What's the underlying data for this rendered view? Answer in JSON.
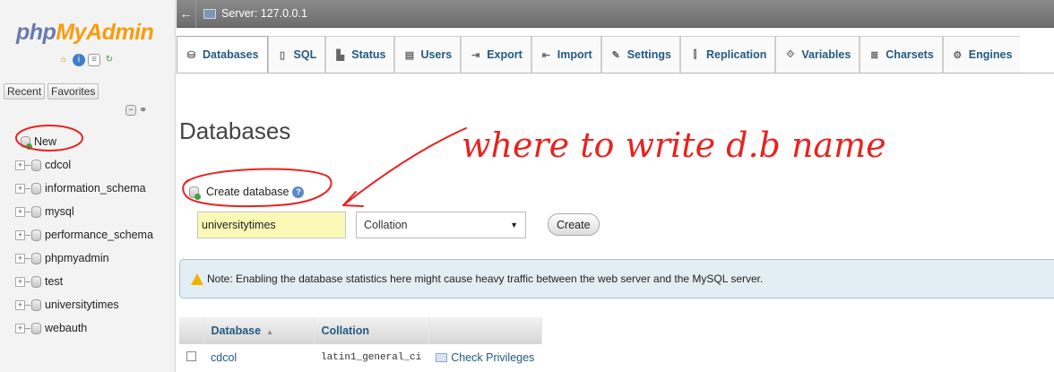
{
  "sidebar": {
    "logo": {
      "php": "php",
      "myadmin": "MyAdmin"
    },
    "logo_icons": [
      "home-icon",
      "info-icon",
      "docs-icon",
      "reload-icon"
    ],
    "nav_tabs": [
      "Recent",
      "Favorites"
    ],
    "tree": {
      "new_label": "New",
      "databases": [
        "cdcol",
        "information_schema",
        "mysql",
        "performance_schema",
        "phpmyadmin",
        "test",
        "universitytimes",
        "webauth"
      ]
    }
  },
  "server_bar": {
    "back": "←",
    "label": "Server: 127.0.0.1"
  },
  "tabs": [
    {
      "label": "Databases",
      "icon": "database-icon"
    },
    {
      "label": "SQL",
      "icon": "sql-icon"
    },
    {
      "label": "Status",
      "icon": "status-icon"
    },
    {
      "label": "Users",
      "icon": "users-icon"
    },
    {
      "label": "Export",
      "icon": "export-icon"
    },
    {
      "label": "Import",
      "icon": "import-icon"
    },
    {
      "label": "Settings",
      "icon": "settings-icon"
    },
    {
      "label": "Replication",
      "icon": "replication-icon"
    },
    {
      "label": "Variables",
      "icon": "variables-icon"
    },
    {
      "label": "Charsets",
      "icon": "charsets-icon"
    },
    {
      "label": "Engines",
      "icon": "engines-icon"
    }
  ],
  "main": {
    "title": "Databases",
    "create_database": {
      "label": "Create database",
      "name_value": "universitytimes",
      "collation_value": "Collation",
      "button": "Create"
    },
    "note": "Note: Enabling the database statistics here might cause heavy traffic between the web server and the MySQL server.",
    "table": {
      "headers": [
        "Database",
        "Collation"
      ],
      "rows": [
        {
          "name": "cdcol",
          "collation": "latin1_general_ci",
          "action": "Check Privileges"
        }
      ]
    }
  },
  "annotation": {
    "text": "where to write d.b name",
    "color": "#e8231f"
  }
}
